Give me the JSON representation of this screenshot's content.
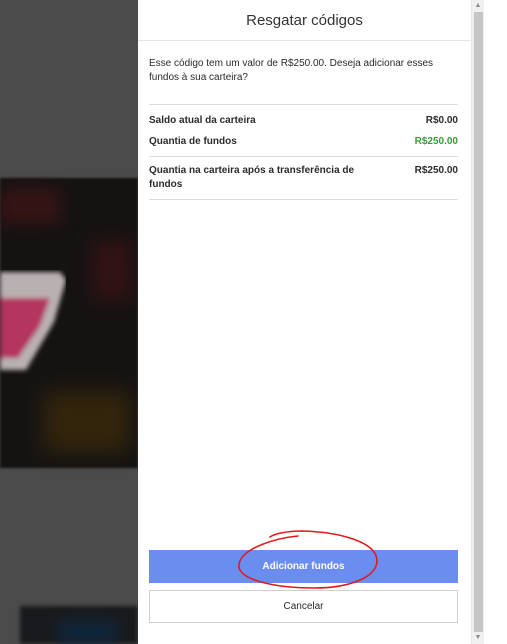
{
  "dialog": {
    "title": "Resgatar códigos",
    "description": "Esse código tem um valor de R$250.00. Deseja adicionar esses fundos à sua carteira?",
    "rows": [
      {
        "label": "Saldo atual da carteira",
        "value": "R$0.00"
      },
      {
        "label": "Quantia de fundos",
        "value": "R$250.00"
      },
      {
        "label": "Quantia na carteira após a transferência de fundos",
        "value": "R$250.00"
      }
    ],
    "primary_button": "Adicionar fundos",
    "secondary_button": "Cancelar"
  },
  "colors": {
    "primary_button": "#6b8def",
    "funds_value": "#3a9c3a",
    "annotation": "#e01b1b"
  },
  "icons": {
    "scroll_up": "triangle-up",
    "scroll_down": "triangle-down"
  }
}
